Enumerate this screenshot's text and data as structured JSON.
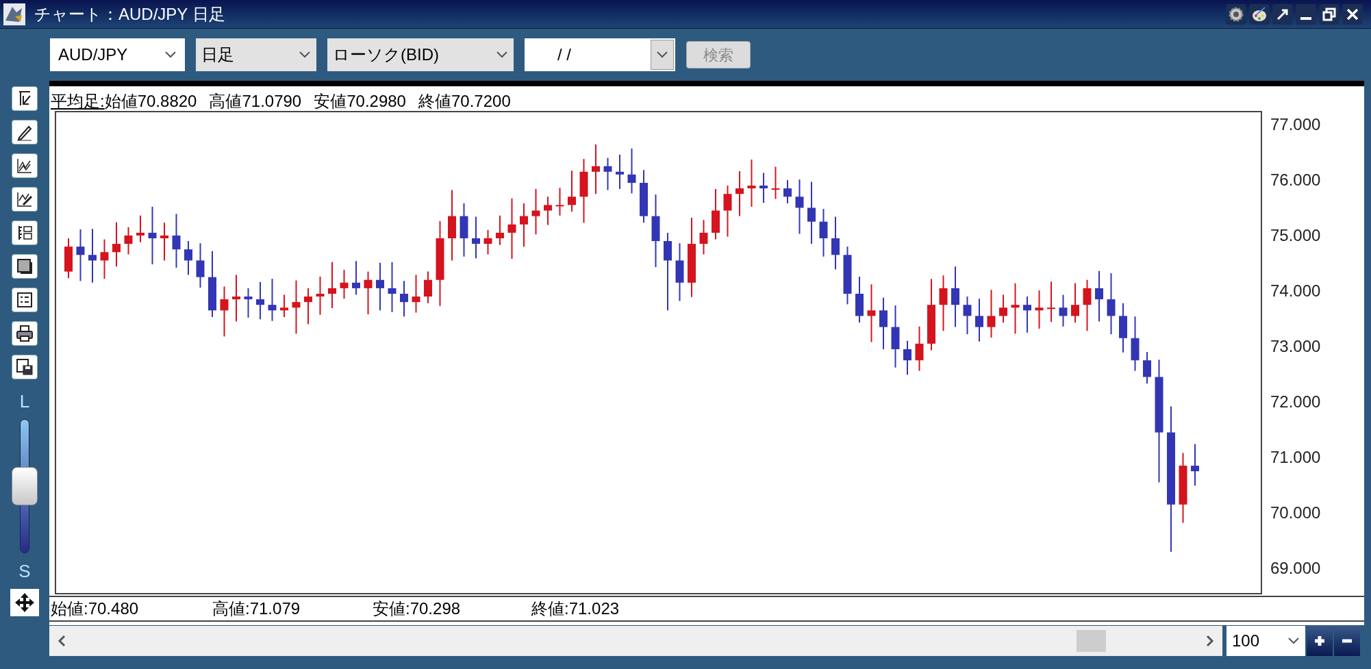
{
  "window": {
    "title": "チャート：AUD/JPY 日足"
  },
  "toolbar": {
    "pair": "AUD/JPY",
    "period": "日足",
    "chart_type": "ローソク(BID)",
    "date": "/ /",
    "search_button": {
      "label": "検索",
      "disabled": true
    }
  },
  "side_tools": {
    "top_label": "L",
    "bottom_label": "S",
    "level": 0.5
  },
  "chart": {
    "heikin": {
      "label": "平均足:",
      "values": [
        "始値70.8820",
        "高値71.0790",
        "安値70.2980",
        "終値70.7200"
      ]
    },
    "y_axis_labels": [
      "77.000",
      "76.000",
      "75.000",
      "74.000",
      "73.000",
      "72.000",
      "71.000",
      "70.000",
      "69.000"
    ],
    "ohlc": [
      "始値:70.480",
      "高値:71.079",
      "安値:70.298",
      "終値:71.023"
    ]
  },
  "bottom_bar": {
    "zoom_value": "100"
  }
}
